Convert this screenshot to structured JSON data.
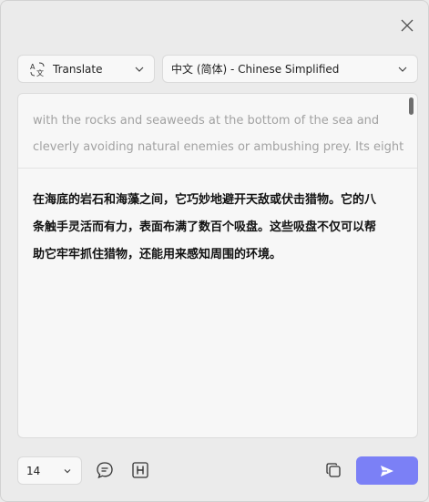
{
  "header": {
    "close_icon": "close-icon"
  },
  "toolbar": {
    "mode": {
      "label": "Translate",
      "icon": "translate-icon"
    },
    "language": {
      "label": "中文 (简体) - Chinese Simplified"
    }
  },
  "source": {
    "lines": [
      "with the rocks and seaweeds at the bottom of the sea and",
      "cleverly avoiding natural enemies or ambushing prey. Its eight"
    ]
  },
  "result": {
    "lines": [
      "在海底的岩石和海藻之间，它巧妙地避开天敌或伏击猎物。它的八",
      "条触手灵活而有力，表面布满了数百个吸盘。这些吸盘不仅可以帮",
      "助它牢牢抓住猎物，还能用来感知周围的环境。"
    ]
  },
  "bottom": {
    "font_size": "14",
    "icons": [
      "chat-bubble-icon",
      "heading-icon",
      "copy-icon",
      "send-icon"
    ]
  },
  "colors": {
    "accent": "#7b80f6",
    "background": "#ebebeb",
    "panel": "#f7f7f7"
  }
}
